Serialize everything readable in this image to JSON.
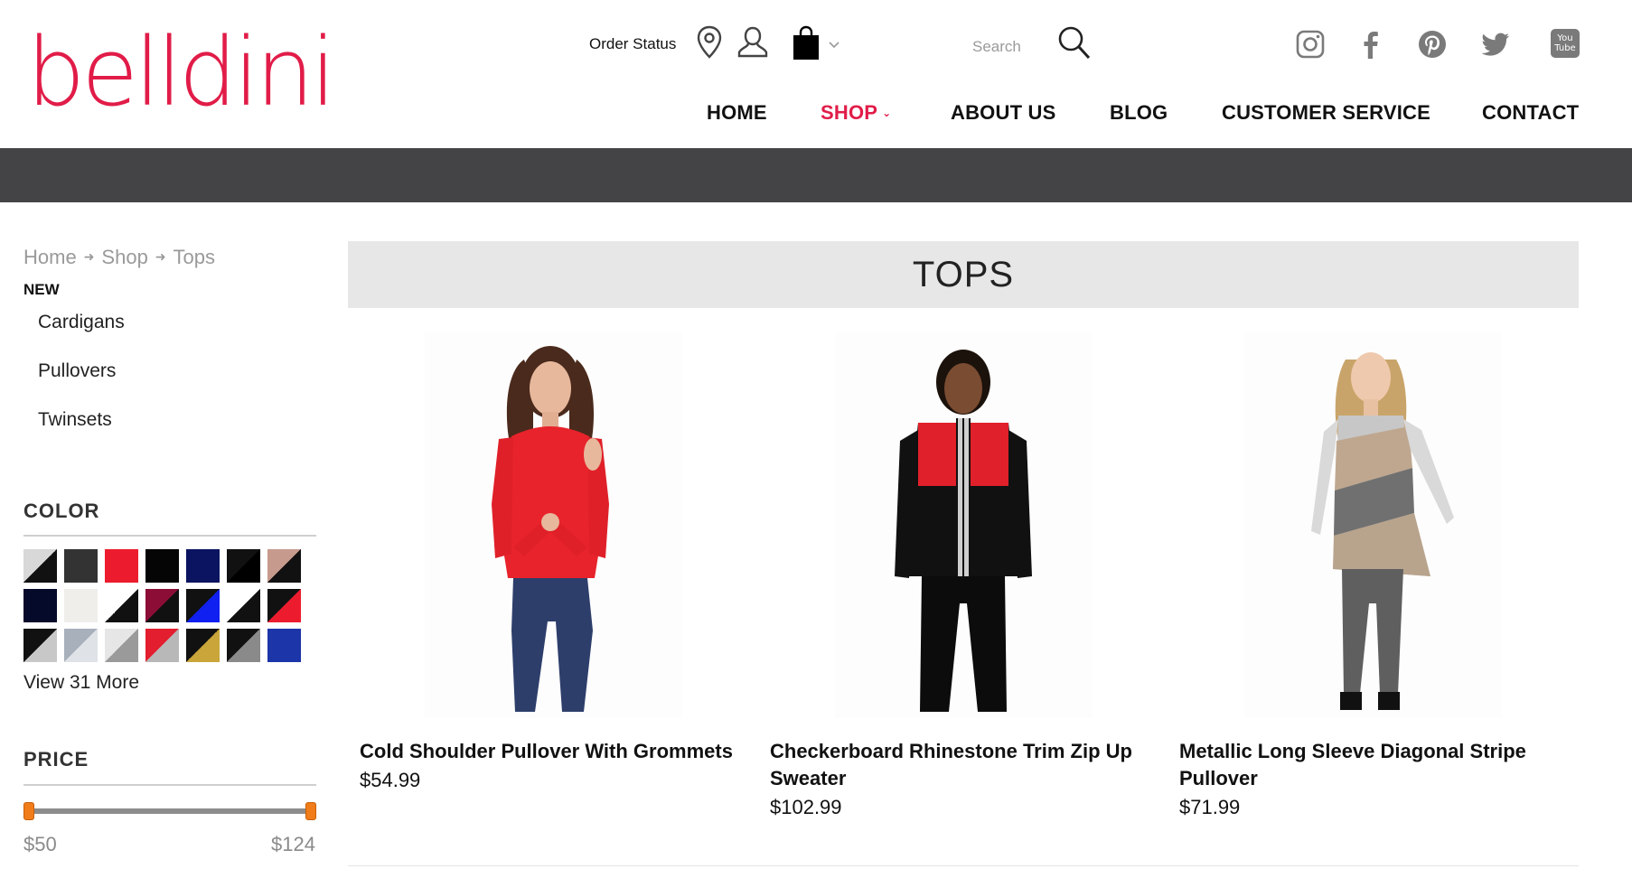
{
  "brand": {
    "logo_text": "belldini",
    "accent": "#e11c48"
  },
  "utility": {
    "order_status": "Order Status",
    "search_placeholder": "Search",
    "icons": [
      "location-pin-icon",
      "account-icon",
      "shopping-bag-icon",
      "search-icon"
    ]
  },
  "social": [
    "instagram-icon",
    "facebook-icon",
    "pinterest-icon",
    "twitter-icon",
    "youtube-icon"
  ],
  "social_labels": {
    "youtube_line1": "You",
    "youtube_line2": "Tube"
  },
  "nav": {
    "home": "HOME",
    "shop": "SHOP",
    "about": "ABOUT US",
    "blog": "BLOG",
    "customer_service": "CUSTOMER SERVICE",
    "contact": "CONTACT"
  },
  "breadcrumb": {
    "home": "Home",
    "shop": "Shop",
    "current": "Tops"
  },
  "sidebar": {
    "new_label": "NEW",
    "subcategories": [
      "Cardigans",
      "Pullovers",
      "Twinsets"
    ],
    "color_title": "COLOR",
    "view_more": "View 31 More",
    "price_title": "PRICE",
    "price_low": "$50",
    "price_high": "$124",
    "swatch_colors": [
      [
        "#d8d8d8/#111111",
        "#333333",
        "#ec1c2e",
        "#050505",
        "#0a1460",
        "#111111/#000000",
        "#c69a8c/#111111"
      ],
      [
        "#050a2a",
        "#f0eeea",
        "#ffffff/#111111",
        "#8c0d35/#111111",
        "#111111/#1020f0",
        "#ffffff/#111111",
        "#111111/#ec1c2e"
      ],
      [
        "#111111/#c8c8c8",
        "#a8b0bb/#dfe2e6",
        "#e6e6e6/#9a9a9a",
        "#e31e2e/#b8b8b8",
        "#111111/#c9a53a",
        "#111111/#8a8a8a",
        "#1c35a8"
      ]
    ]
  },
  "page_title": "TOPS",
  "products": [
    {
      "name": "Cold Shoulder Pullover With Grommets",
      "price": "$54.99"
    },
    {
      "name": "Checkerboard Rhinestone Trim Zip Up Sweater",
      "price": "$102.99"
    },
    {
      "name": "Metallic Long Sleeve Diagonal Stripe Pullover",
      "price": "$71.99"
    }
  ]
}
